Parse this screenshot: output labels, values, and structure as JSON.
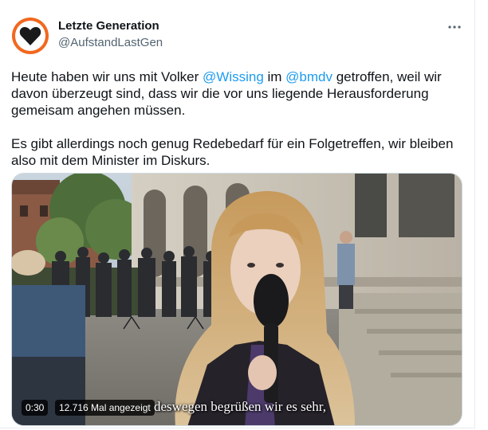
{
  "account": {
    "display_name": "Letzte Generation",
    "handle": "@AufstandLastGen",
    "avatar_icon": "heart-logo-icon",
    "avatar_color": "#f2681f"
  },
  "more_icon": "more-dots-icon",
  "tweet": {
    "p1_before": "Heute haben wir uns mit Volker ",
    "mention1": "@Wissing",
    "p1_middle": " im ",
    "mention2": "@bmdv",
    "p1_after": " getroffen, weil wir davon überzeugt sind, dass wir die vor uns liegende Herausforderung gemeisam angehen müssen.",
    "p2": "Es gibt allerdings noch genug Redebedarf für ein Folgetreffen, wir bleiben also mit dem Minister im Diskurs.",
    "mention_color": "#1d9bf0"
  },
  "video": {
    "duration": "0:30",
    "views": "12.716 Mal angezeigt",
    "subtitle": "deswegen begrüßen wir es sehr,"
  }
}
